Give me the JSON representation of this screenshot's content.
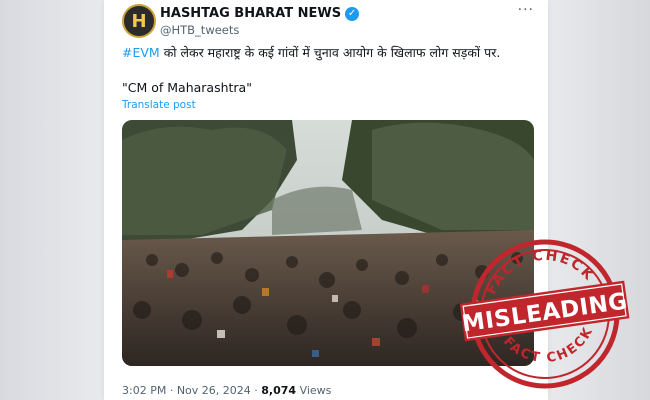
{
  "post": {
    "author_name": "HASHTAG BHARAT NEWS",
    "handle": "@HTB_tweets",
    "avatar_letter": "H",
    "more_label": "···",
    "hashtag": "#EVM",
    "text_rest": " को लेकर महाराष्ट्र के कई गांवों में चुनाव आयोग के खिलाफ लोग सड़कों पर.",
    "quote_line": "\"CM of Maharashtra\"",
    "translate_label": "Translate post",
    "footer": {
      "time": "3:02 PM",
      "sep1": " · ",
      "date": "Nov 26, 2024",
      "sep2": " · ",
      "views_count": "8,074",
      "views_label": " Views"
    }
  },
  "stamp": {
    "top_text": "FACT CHECK",
    "bottom_text": "FACT CHECK",
    "verdict": "MISLEADING",
    "color": "#c0262c"
  },
  "colors": {
    "accent": "#1d9bf0",
    "text": "#0f1419",
    "muted": "#536471"
  }
}
